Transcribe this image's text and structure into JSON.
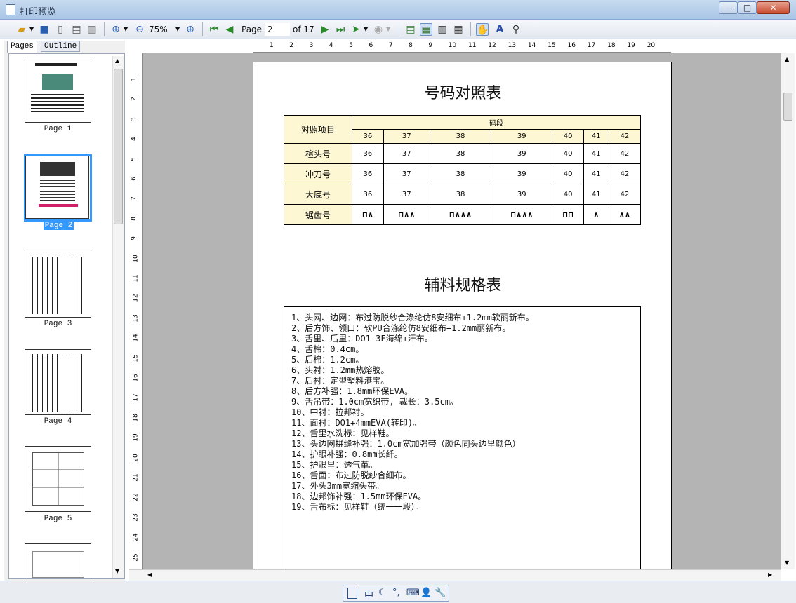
{
  "window": {
    "title": "打印预览",
    "min": "—",
    "max": "□",
    "close": "✕"
  },
  "toolbar": {
    "zoom": "75%",
    "page_label": "Page",
    "page_value": "2",
    "of_pages": "of 17"
  },
  "tabs": {
    "pages": "Pages",
    "outline": "Outline"
  },
  "thumbs": [
    "Page 1",
    "Page 2",
    "Page 3",
    "Page 4",
    "Page 5"
  ],
  "ruler": {
    "h": [
      "1",
      "2",
      "3",
      "4",
      "5",
      "6",
      "7",
      "8",
      "9",
      "10",
      "11",
      "12",
      "13",
      "14",
      "15",
      "16",
      "17",
      "18",
      "19",
      "20"
    ],
    "v": [
      "1",
      "2",
      "3",
      "4",
      "5",
      "6",
      "7",
      "8",
      "9",
      "10",
      "11",
      "12",
      "13",
      "14",
      "15",
      "16",
      "17",
      "18",
      "19",
      "20",
      "21",
      "22",
      "23",
      "24",
      "25"
    ]
  },
  "doc": {
    "title1": "号码对照表",
    "col_header": "对照项目",
    "group_header": "码段",
    "sizes": [
      "36",
      "37",
      "38",
      "39",
      "40",
      "41",
      "42"
    ],
    "rows": [
      {
        "label": "楦头号",
        "values": [
          "36",
          "37",
          "38",
          "39",
          "40",
          "41",
          "42"
        ]
      },
      {
        "label": "冲刀号",
        "values": [
          "36",
          "37",
          "38",
          "39",
          "40",
          "41",
          "42"
        ]
      },
      {
        "label": "大底号",
        "values": [
          "36",
          "37",
          "38",
          "39",
          "40",
          "41",
          "42"
        ]
      },
      {
        "label": "锯齿号",
        "values": [
          "⊓∧",
          "⊓∧∧",
          "⊓∧∧∧",
          "⊓∧∧∧",
          "⊓⊓",
          "∧",
          "∧∧"
        ]
      }
    ],
    "title2": "辅料规格表",
    "specs": [
      "1、头网、边网：布过防脱纱合涤纶仿8安细布+1.2mm软丽新布。",
      "2、后方饰、领口：软PU合涤纶仿8安细布+1.2mm丽新布。",
      "3、舌里、后里：DO1+3F海绵+汗布。",
      "4、舌棉：0.4cm。",
      "5、后棉：1.2cm。",
      "6、头衬：1.2mm热熔胶。",
      "7、后衬：定型塑料港宝。",
      "8、后方补强：1.8mm环保EVA。",
      "9、舌吊带：1.0cm宽织带, 裁长：3.5cm。",
      "10、中衬：拉邦衬。",
      "11、面衬：DO1+4mmEVA(转印)。",
      "12、舌里水洗标：见样鞋。",
      "13、头边网拼缝补强：1.0cm宽加强带（颜色同头边里颜色）",
      "14、护眼补强：0.8mm长纤。",
      "15、护眼里：透气革。",
      "16、舌面：布过防脱纱合细布。",
      "17、外头3mm宽缩头带。",
      "18、边邦饰补强：1.5mm环保EVA。",
      "19、舌布标：见样鞋（统一一段）。"
    ]
  },
  "ime": {
    "chars": [
      "中",
      "☾",
      "°,",
      "⌨",
      "👤",
      "🔧"
    ]
  },
  "colors": {
    "table_header_bg": "#fdf7d4",
    "selection": "#3399ff",
    "viewer_bg": "#b4b4b4"
  }
}
